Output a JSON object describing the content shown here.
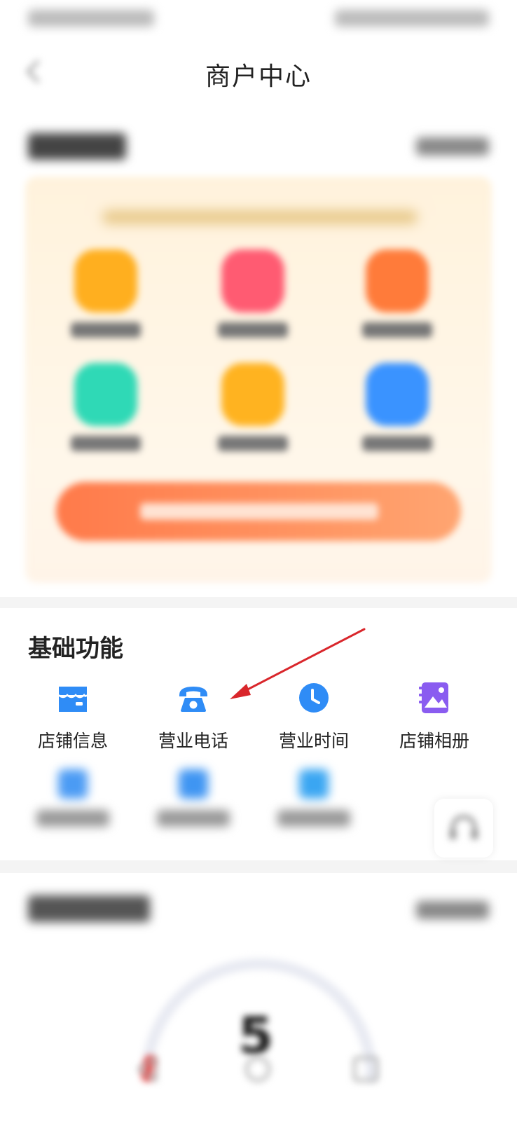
{
  "nav": {
    "title": "商户中心"
  },
  "basic": {
    "title": "基础功能",
    "items": [
      {
        "label": "店铺信息",
        "icon": "storefront-icon"
      },
      {
        "label": "营业电话",
        "icon": "telephone-icon"
      },
      {
        "label": "营业时间",
        "icon": "clock-icon"
      },
      {
        "label": "店铺相册",
        "icon": "photo-album-icon"
      }
    ]
  },
  "score": {
    "value": "5"
  },
  "colors": {
    "accent_blue": "#2f8cf6",
    "album_purple": "#8a5cf0",
    "cta_orange": "#ff7a4a",
    "annotation_red": "#d9262b"
  }
}
